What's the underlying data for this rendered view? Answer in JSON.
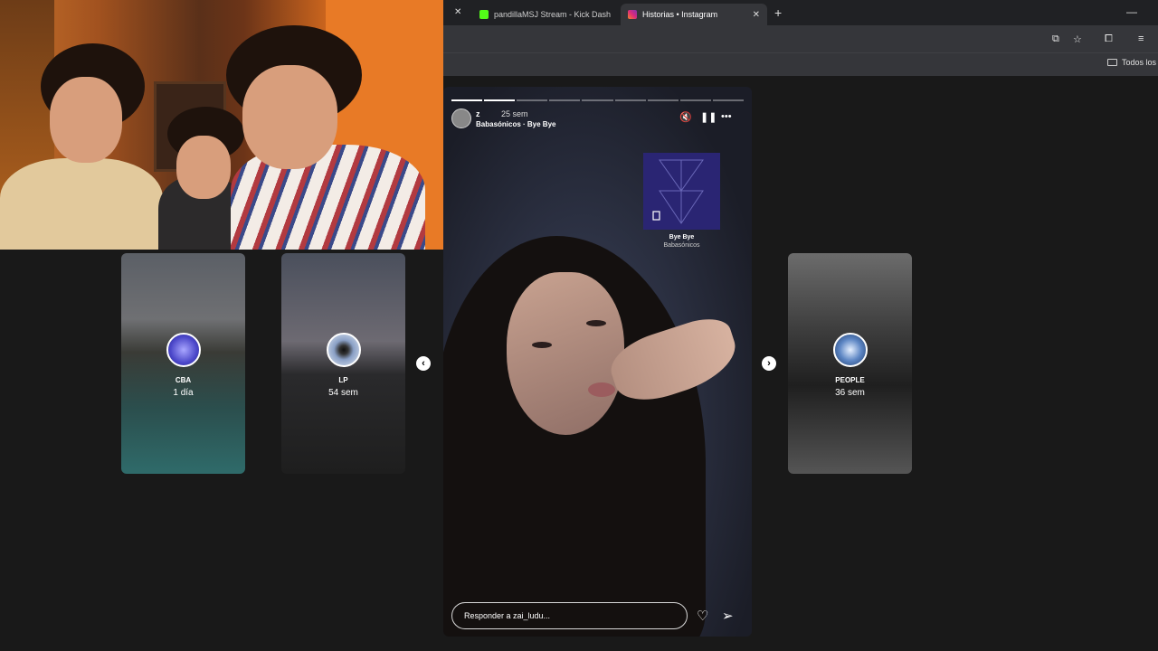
{
  "browser": {
    "tabs": [
      {
        "label": "pandillaMSJ Stream - Kick Dash",
        "active": false,
        "favicon_color": "#53fc18"
      },
      {
        "label": "Historias • Instagram",
        "active": true,
        "favicon_color": "#e1306c"
      }
    ],
    "new_tab_label": "+",
    "minimize_label": "—",
    "bookmarks_folder": "Todos los m"
  },
  "stories_left": [
    {
      "username": "CBA",
      "time": "1 día"
    },
    {
      "username": "LP",
      "time": "54 sem"
    }
  ],
  "story_right": {
    "username": "PEOPLE",
    "time": "36 sem"
  },
  "main_story": {
    "username": "z",
    "time": "25 sem",
    "music_label": "Babasónicos · Bye Bye",
    "song_title": "Bye Bye",
    "song_artist": "Babasónicos",
    "reply_placeholder": "Responder a zai_ludu...",
    "progress_total": 9,
    "progress_done": 2
  },
  "colors": {
    "accent_kick": "#53fc18",
    "accent_instagram": "#e1306c",
    "music_card": "#2a2573"
  }
}
